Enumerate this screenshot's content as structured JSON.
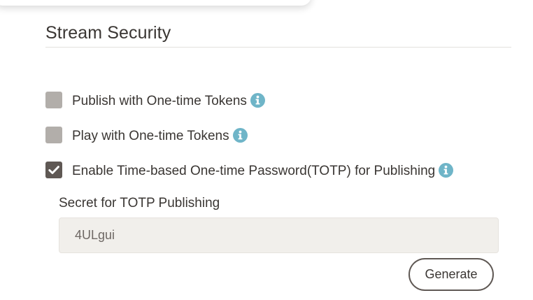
{
  "section": {
    "title": "Stream Security"
  },
  "options": [
    {
      "label": "Publish with One-time Tokens",
      "checked": false,
      "info_icon": "info-circle-icon"
    },
    {
      "label": "Play with One-time Tokens",
      "checked": false,
      "info_icon": "info-circle-icon"
    },
    {
      "label": "Enable Time-based One-time Password(TOTP) for Publishing",
      "checked": true,
      "info_icon": "info-circle-icon"
    }
  ],
  "totp": {
    "secret_label": "Secret for TOTP Publishing",
    "secret_value": "4ULgui",
    "generate_label": "Generate"
  },
  "colors": {
    "text": "#3a3633",
    "checkbox_unchecked": "#b2aeaa",
    "checkbox_checked": "#5f5854",
    "info_icon": "#6fb5c8",
    "input_background": "#f1efeb"
  }
}
